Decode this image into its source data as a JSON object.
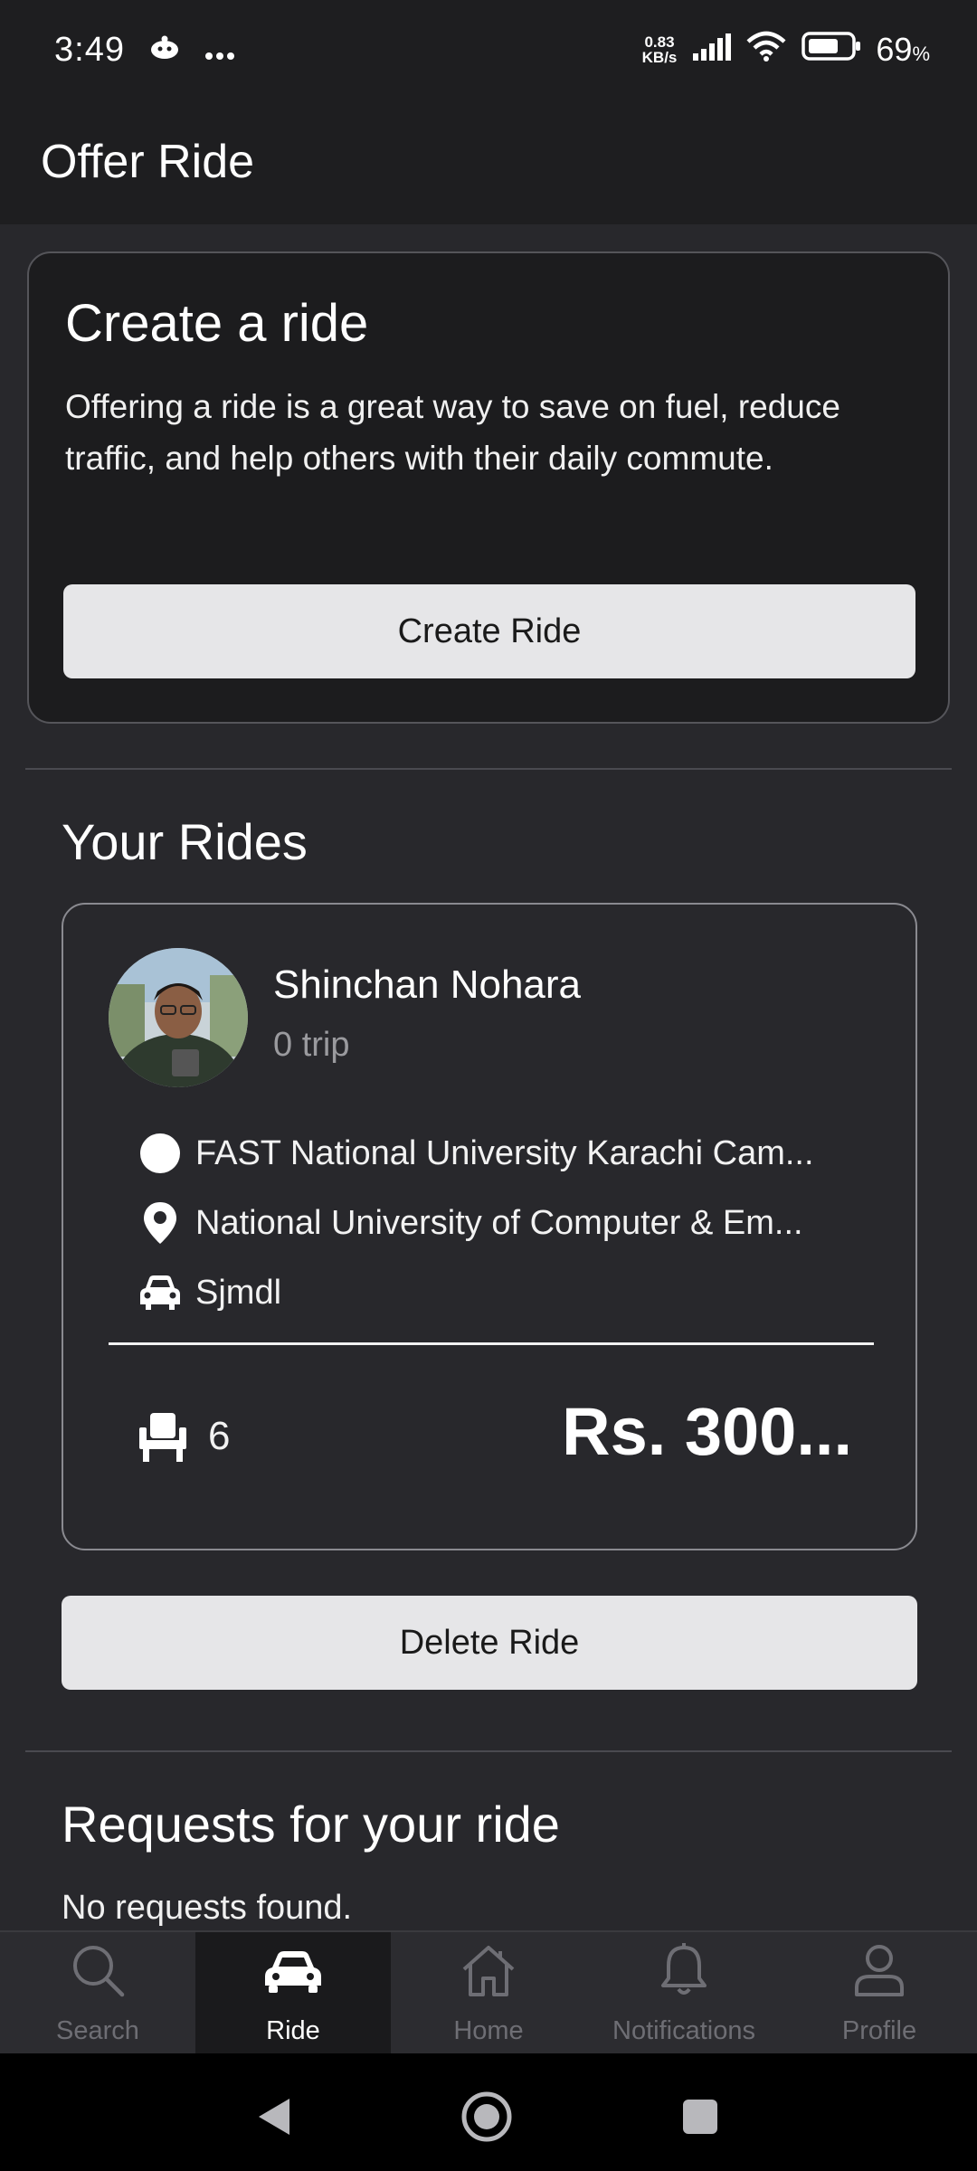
{
  "status_bar": {
    "time": "3:49",
    "net_speed_value": "0.83",
    "net_speed_unit": "KB/s",
    "battery_percent": "69",
    "battery_unit": "%",
    "icons": [
      "notification-app-icon",
      "more-dots-icon",
      "signal-icon",
      "wifi-icon",
      "battery-icon"
    ]
  },
  "app_bar": {
    "title": "Offer Ride"
  },
  "create_card": {
    "title": "Create a ride",
    "description": "Offering a ride is a great way to save on fuel, reduce traffic, and help others with their daily commute.",
    "button_label": "Create Ride"
  },
  "your_rides": {
    "title": "Your Rides",
    "ride": {
      "driver_name": "Shinchan Nohara",
      "trip_count": "0 trip",
      "origin": "FAST National University Karachi Cam...",
      "destination": "National University of Computer & Em...",
      "vehicle": "Sjmdl",
      "seats": "6",
      "price": "Rs. 300..."
    },
    "delete_label": "Delete Ride"
  },
  "requests": {
    "title": "Requests for your ride",
    "empty_text": "No requests found."
  },
  "bottom_nav": {
    "items": [
      {
        "label": "Search",
        "icon": "search-icon",
        "active": false
      },
      {
        "label": "Ride",
        "icon": "car-icon",
        "active": true
      },
      {
        "label": "Home",
        "icon": "home-icon",
        "active": false
      },
      {
        "label": "Notifications",
        "icon": "bell-icon",
        "active": false
      },
      {
        "label": "Profile",
        "icon": "person-icon",
        "active": false
      }
    ]
  },
  "system_nav": {
    "icons": [
      "back-icon",
      "home-circle-icon",
      "recents-icon"
    ]
  },
  "colors": {
    "background": "#28282c",
    "surface": "#1c1c1e",
    "button": "#e6e6e8",
    "active_nav": "#1a1a1c"
  }
}
